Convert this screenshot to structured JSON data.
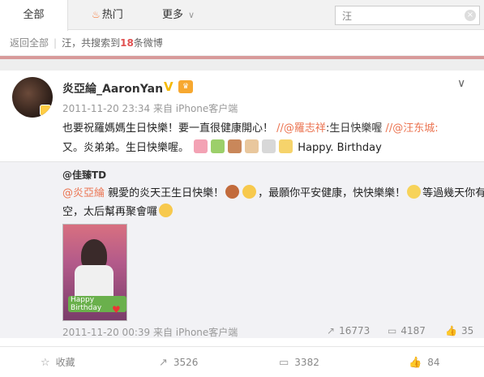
{
  "tabs": {
    "all": "全部",
    "hot": "热门",
    "more": "更多"
  },
  "search": {
    "value": "汪"
  },
  "result": {
    "back": "返回全部",
    "keyword": "汪",
    "prefix": "，共搜索到",
    "count": "18",
    "suffix": "条微博"
  },
  "post": {
    "username": "炎亞綸_AaronYan",
    "meta": "2011-11-20 23:34 来自 iPhone客户端",
    "text_part1": "也要祝羅媽媽生日快樂！要一直很健康開心！",
    "sep1": "//",
    "mention1": "@羅志祥",
    "quote1": ":生日快樂喔",
    "sep2": "//",
    "mention2": "@汪东城",
    "mention2_colon": ":",
    "text_part2": "又。炎弟弟。生日快樂喔。",
    "text_part3": "Happy. Birthday"
  },
  "repost": {
    "username": "@佳臻TD",
    "mention": "@炎亞綸",
    "text1a": " 親愛的炎天王生日快樂！",
    "text1b": "，最願你平安健康，快快樂樂！",
    "text1c": "等過幾天你有",
    "text2": "空，太后幫再聚會囉",
    "photo_label": "Happy Birthday",
    "meta": "2011-11-20 00:39 来自 iPhone客户端",
    "forwards": "16773",
    "comments": "4187",
    "likes": "35"
  },
  "actions": {
    "favorite": "收藏",
    "forward": "3526",
    "comment": "3382",
    "like": "84"
  },
  "colors": {
    "accent": "#eb7350",
    "count": "#e05050",
    "verified": "#f5b800"
  }
}
